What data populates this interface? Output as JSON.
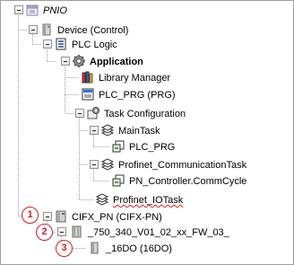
{
  "tree": {
    "root": {
      "label": "PNIO",
      "icon": "project-icon"
    },
    "device": {
      "label": "Device (Control)",
      "icon": "device-icon"
    },
    "plc_logic": {
      "label": "PLC Logic",
      "icon": "plc-logic-icon"
    },
    "application": {
      "label": "Application",
      "icon": "application-gear-icon"
    },
    "library_manager": {
      "label": "Library Manager",
      "icon": "library-books-icon"
    },
    "plc_prg": {
      "label": "PLC_PRG (PRG)",
      "icon": "program-pou-icon"
    },
    "task_configuration": {
      "label": "Task Configuration",
      "icon": "task-configuration-icon"
    },
    "main_task": {
      "label": "MainTask",
      "icon": "task-icon"
    },
    "main_task_call": {
      "label": "PLC_PRG",
      "icon": "program-call-icon"
    },
    "profinet_comm_task": {
      "label": "Profinet_CommunicationTask",
      "icon": "task-icon"
    },
    "profinet_comm_call": {
      "label": "PN_Controller.CommCycle",
      "icon": "program-call-icon"
    },
    "profinet_io_task": {
      "label": "Profinet_IOTask",
      "icon": "task-icon"
    },
    "cifx": {
      "label": "CIFX_PN (CIFX-PN)",
      "icon": "fieldbus-device-icon"
    },
    "device_750": {
      "label": "_750_340_V01_02_xx_FW_03_",
      "icon": "io-device-icon"
    },
    "module_16do": {
      "label": "_16DO (16DO)",
      "icon": "module-icon"
    }
  },
  "callouts": [
    "1",
    "2",
    "3"
  ],
  "colors": {
    "callout": "#d11e2a",
    "tree_line": "#a0a0a0",
    "error_squiggle": "#e01f1f"
  }
}
